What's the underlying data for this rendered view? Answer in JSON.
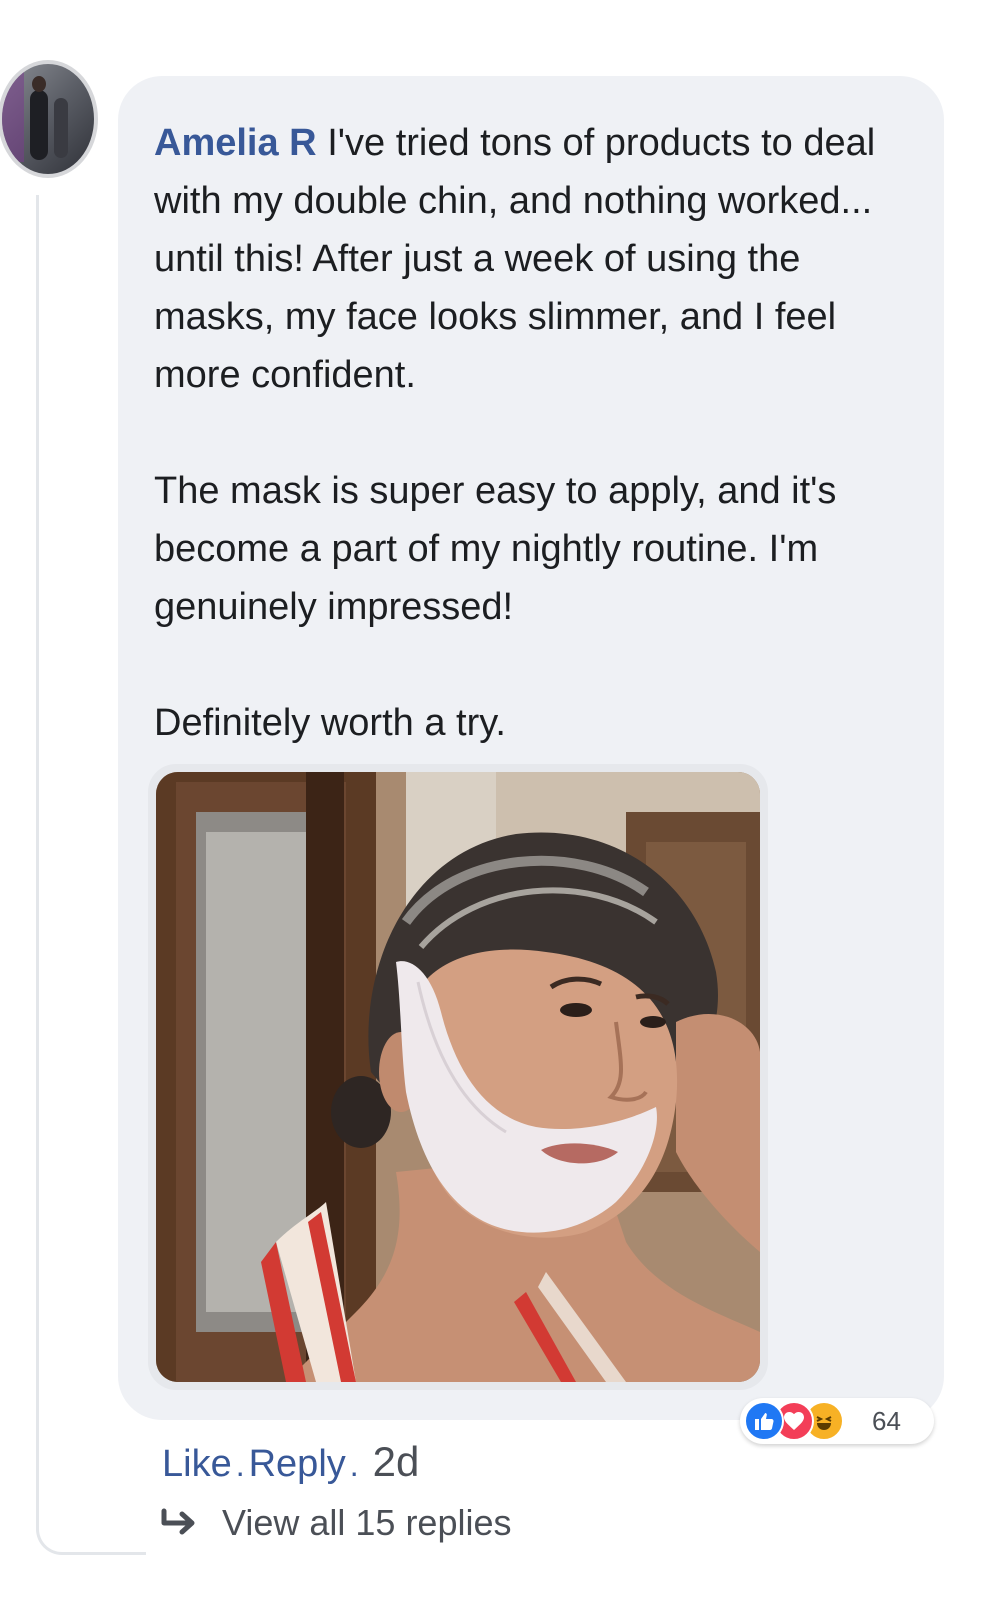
{
  "comment": {
    "author": "Amelia R",
    "paragraphs": [
      "I've tried tons of products to deal with my double chin, and nothing worked... until this! After just a week of using the masks, my face looks slimmer, and I feel more confident.",
      "The mask is super easy to apply, and it's become a part of my nightly routine. I'm genuinely impressed!",
      "Definitely worth a try."
    ]
  },
  "reactions": {
    "icons": [
      "like-icon",
      "love-icon",
      "haha-icon"
    ],
    "count": "64",
    "colors": {
      "like": "#2078f4",
      "love": "#f33e58",
      "haha": "#f7b125"
    }
  },
  "actions": {
    "like_label": "Like",
    "separator": ".",
    "reply_label": "Reply",
    "time": "2d"
  },
  "replies": {
    "label": "View all 15 replies"
  },
  "colors": {
    "author": "#385898",
    "bubble": "#eff1f5",
    "text": "#1c1e21",
    "muted": "#4b4f56"
  }
}
